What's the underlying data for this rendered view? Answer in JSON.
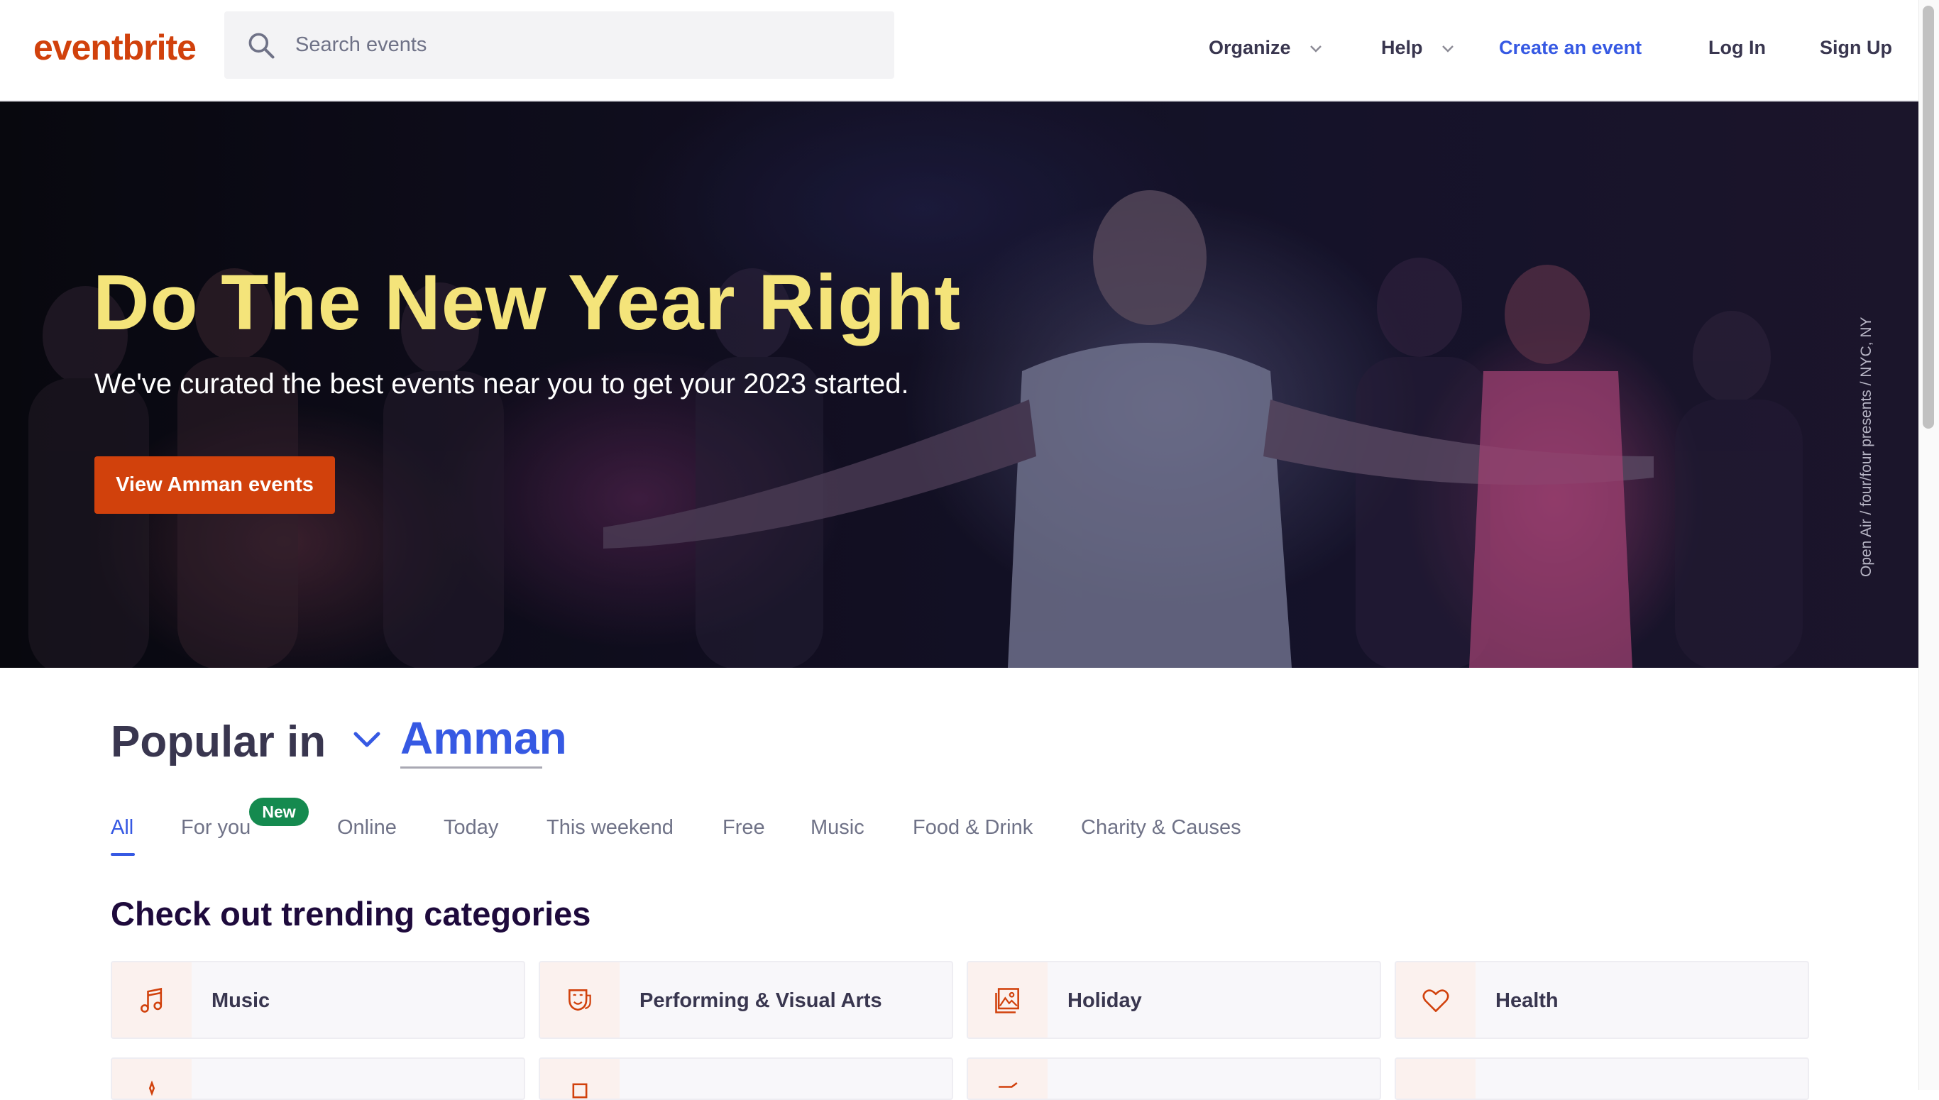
{
  "header": {
    "logo": "eventbrite",
    "search_placeholder": "Search events",
    "nav": {
      "organize": "Organize",
      "help": "Help",
      "create_event": "Create an event",
      "login": "Log In",
      "signup": "Sign Up"
    }
  },
  "hero": {
    "title": "Do The New Year Right",
    "subtitle": "We've curated the best events near you to get your 2023 started.",
    "cta": "View Amman events",
    "photo_credit": "Open Air / four/four presents / NYC, NY"
  },
  "popular": {
    "label": "Popular in",
    "city": "Amman"
  },
  "tabs": {
    "items": [
      "All",
      "For you",
      "Online",
      "Today",
      "This weekend",
      "Free",
      "Music",
      "Food & Drink",
      "Charity & Causes"
    ],
    "active": "All",
    "new_badge": "New"
  },
  "trending": {
    "title": "Check out trending categories",
    "categories": [
      {
        "label": "Music",
        "icon": "music-note-icon"
      },
      {
        "label": "Performing & Visual Arts",
        "icon": "theater-mask-icon"
      },
      {
        "label": "Holiday",
        "icon": "picture-frame-icon"
      },
      {
        "label": "Health",
        "icon": "heart-icon"
      }
    ]
  },
  "colors": {
    "brand": "#d1410c",
    "link_blue": "#3659e3",
    "hero_title": "#f4e47a",
    "new_badge": "#158a4f",
    "text_dark": "#39364f"
  }
}
